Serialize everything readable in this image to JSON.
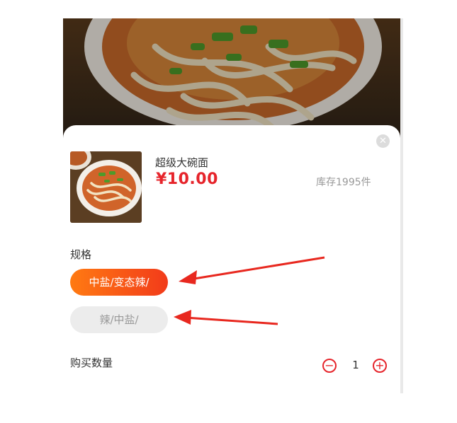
{
  "product": {
    "name": "超级大碗面",
    "price": "¥10.00",
    "stock": "库存1995件"
  },
  "spec": {
    "label": "规格",
    "options": [
      {
        "label": "中盐/变态辣/",
        "selected": true
      },
      {
        "label": "辣/中盐/",
        "selected": false
      }
    ]
  },
  "quantity": {
    "label": "购买数量",
    "value": "1",
    "minus_icon": "minus-circle-icon",
    "plus_icon": "plus-circle-icon"
  },
  "sheet": {
    "close_icon": "close-icon"
  },
  "colors": {
    "accent": "#e6242b",
    "gradient_start": "#ff7a12",
    "gradient_end": "#f23b1a",
    "annotation": "#e8281f"
  }
}
